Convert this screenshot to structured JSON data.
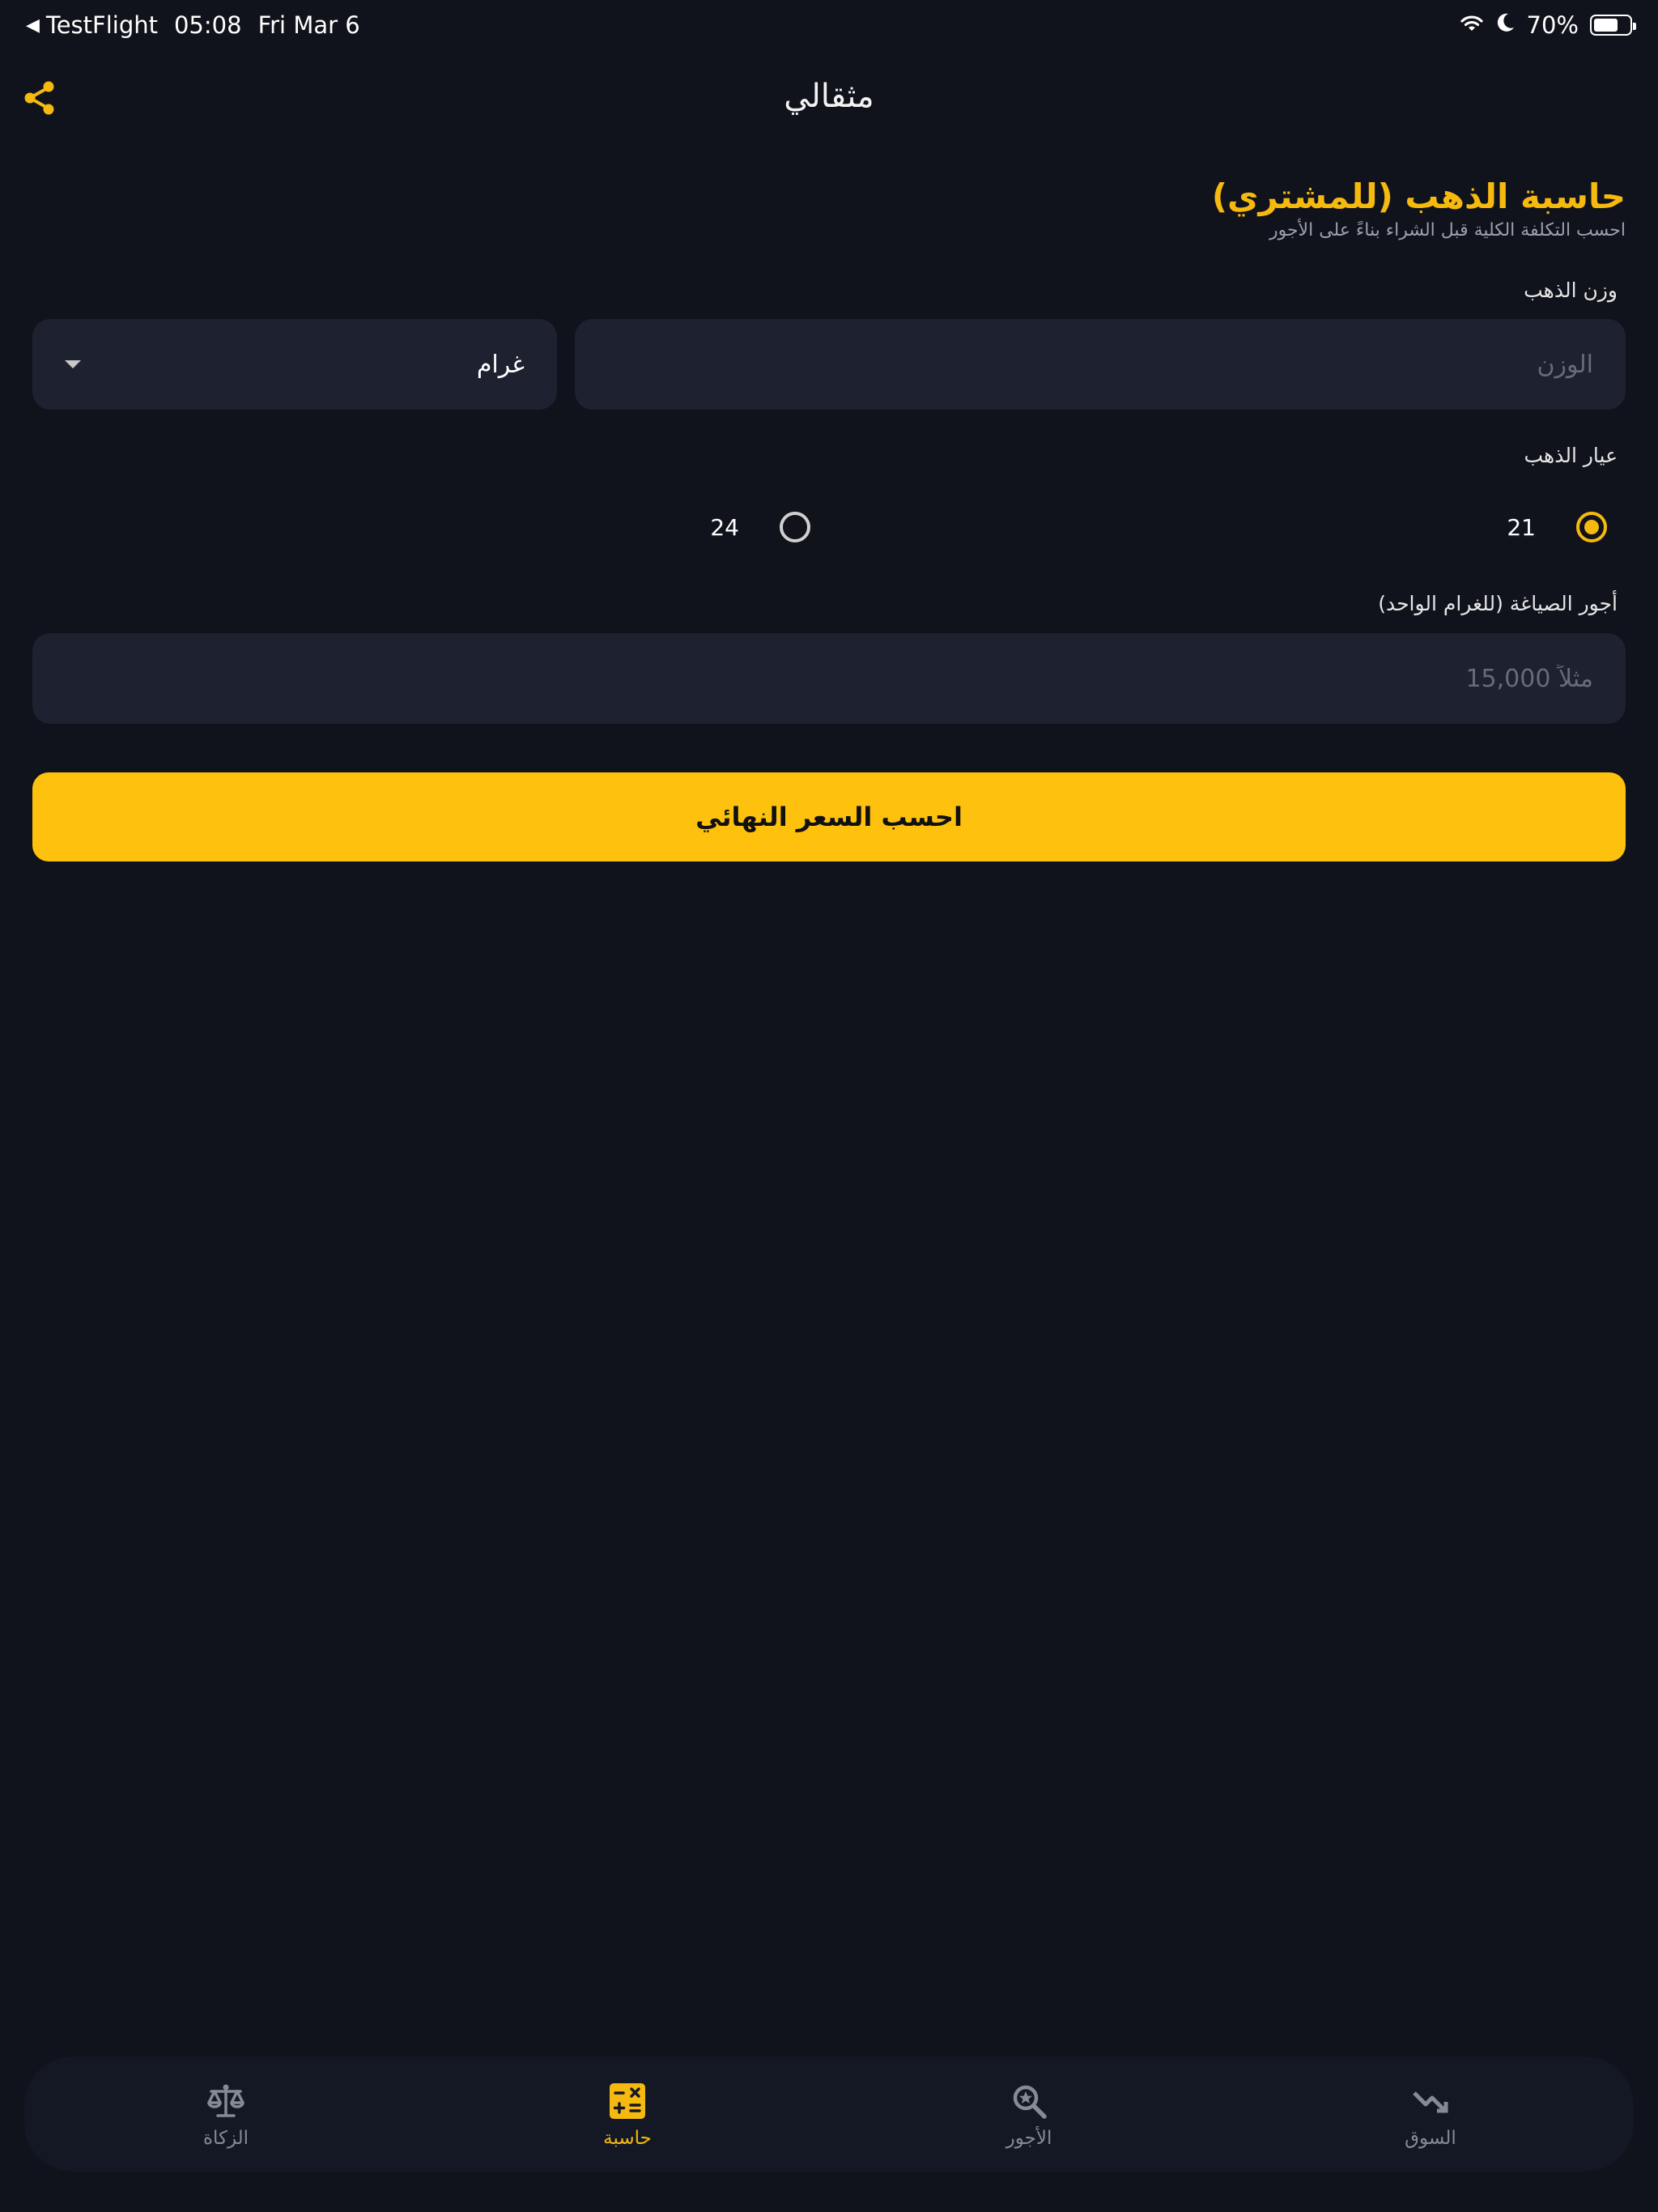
{
  "status_bar": {
    "back_app": "TestFlight",
    "time": "05:08",
    "date": "Fri Mar 6",
    "battery": "70%",
    "battery_level": 0.7
  },
  "nav": {
    "title": "مثقالي"
  },
  "calculator": {
    "title": "حاسبة الذهب (للمشتري)",
    "subtitle": "احسب التكلفة الكلية قبل الشراء بناءً على الأجور",
    "weight": {
      "label": "وزن الذهب",
      "placeholder": "الوزن",
      "value": "",
      "unit": "غرام"
    },
    "karat": {
      "label": "عيار الذهب",
      "options": [
        {
          "label": "21",
          "selected": true
        },
        {
          "label": "24",
          "selected": false
        }
      ]
    },
    "fee": {
      "label": "أجور الصياغة (للغرام الواحد)",
      "placeholder": "مثلاً 15,000",
      "value": ""
    },
    "submit_label": "احسب السعر النهائي"
  },
  "tabs": [
    {
      "label": "السوق",
      "icon": "trend-down-icon",
      "active": false
    },
    {
      "label": "الأجور",
      "icon": "search-star-icon",
      "active": false
    },
    {
      "label": "حاسبة",
      "icon": "calculator-icon",
      "active": true
    },
    {
      "label": "الزكاة",
      "icon": "scale-icon",
      "active": false
    }
  ],
  "colors": {
    "background": "#10131b",
    "accent": "#fec10d",
    "field": "#1d2130",
    "tab_bar": "#141824"
  }
}
